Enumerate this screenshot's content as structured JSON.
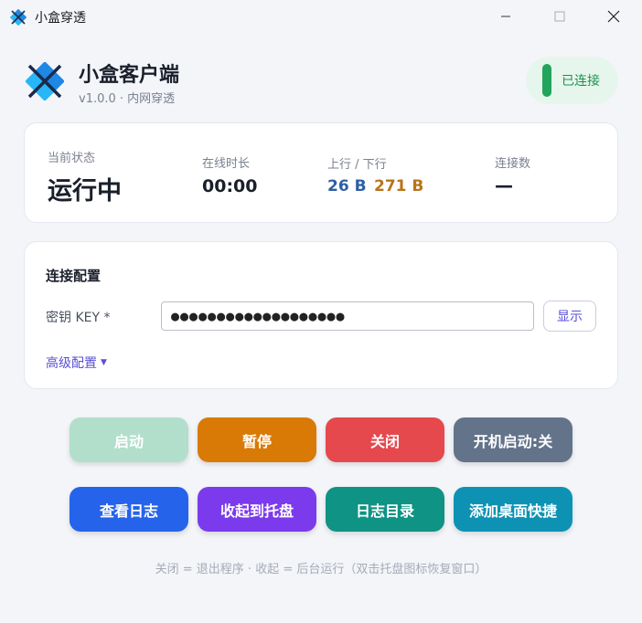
{
  "window": {
    "title": "小盒穿透"
  },
  "header": {
    "app_name": "小盒客户端",
    "subtitle": "v1.0.0 · 内网穿透",
    "connection_status": "已连接",
    "connection_color": "#22a45d"
  },
  "status": {
    "state_label": "当前状态",
    "state_value": "运行中",
    "uptime_label": "在线时长",
    "uptime_value": "00:00",
    "traffic_label": "上行 / 下行",
    "upload_value": "26 B",
    "upload_color": "#2d5fa3",
    "download_value": "271 B",
    "download_color": "#b8741a",
    "connections_label": "连接数",
    "connections_value": "—"
  },
  "config": {
    "title": "连接配置",
    "key_label": "密钥 KEY *",
    "key_value": "●●●●●●●●●●●●●●●●●●●",
    "show_label": "显示",
    "advanced_label": "高级配置",
    "advanced_caret": "▼"
  },
  "buttons": {
    "start": {
      "label": "启动",
      "color": "#b2dfcc"
    },
    "pause": {
      "label": "暂停",
      "color": "#d97a06"
    },
    "close": {
      "label": "关闭",
      "color": "#e5484d"
    },
    "autostart": {
      "label": "开机启动:关",
      "color": "#63738a"
    },
    "view_log": {
      "label": "查看日志",
      "color": "#2563eb"
    },
    "minimize_tray": {
      "label": "收起到托盘",
      "color": "#7c3aed"
    },
    "log_dir": {
      "label": "日志目录",
      "color": "#0f9384"
    },
    "desktop_shortcut": {
      "label": "添加桌面快捷",
      "color": "#0e92b4"
    }
  },
  "footer": {
    "note": "关闭 = 退出程序 · 收起 = 后台运行（双击托盘图标恢复窗口）"
  }
}
